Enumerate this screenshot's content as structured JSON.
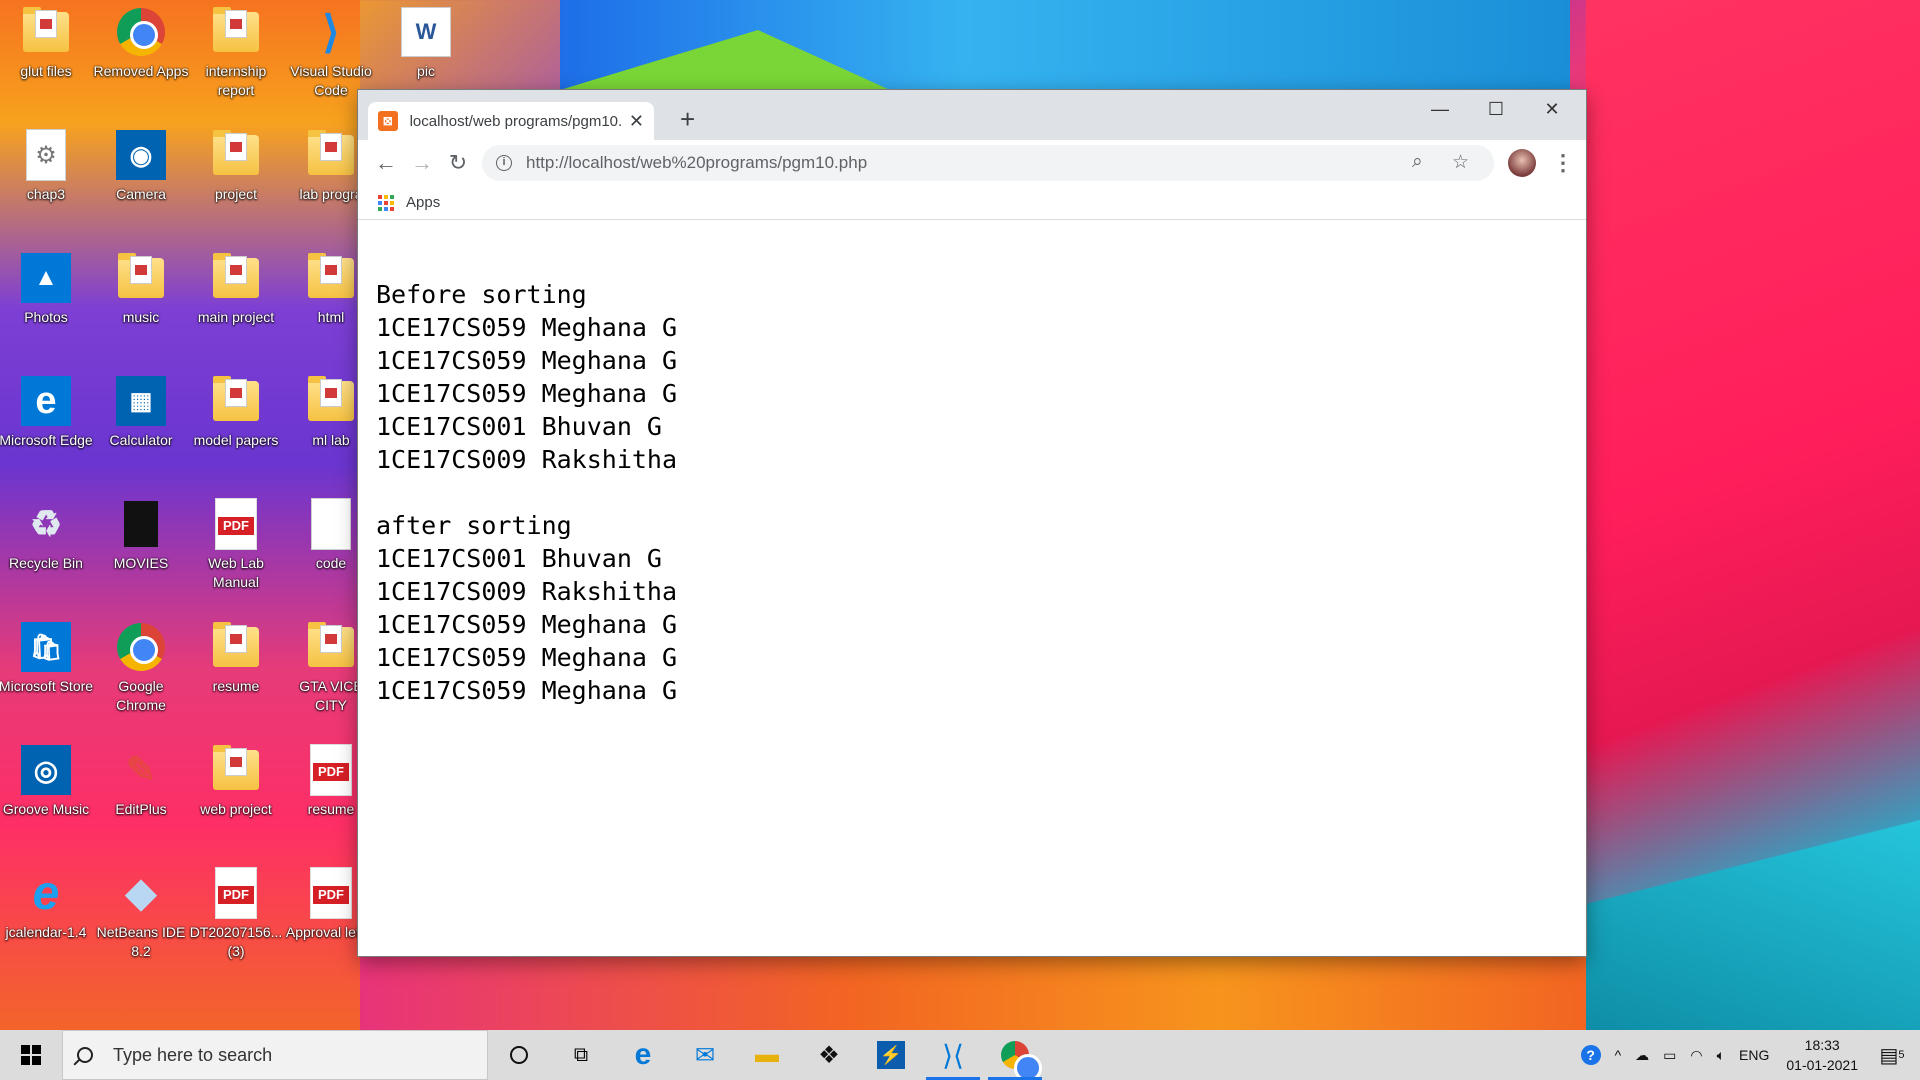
{
  "desktop": {
    "icons": [
      {
        "label": "glut files",
        "type": "folder"
      },
      {
        "label": "Removed Apps",
        "type": "chrome"
      },
      {
        "label": "internship report",
        "type": "folder"
      },
      {
        "label": "Visual Studio Code",
        "type": "vscode"
      },
      {
        "label": "pic",
        "type": "word"
      },
      {
        "label": "chap3",
        "type": "settings-file"
      },
      {
        "label": "Camera",
        "type": "camera"
      },
      {
        "label": "project",
        "type": "pdf-folder"
      },
      {
        "label": "lab progra",
        "type": "folder"
      },
      {
        "label": "Photos",
        "type": "photos"
      },
      {
        "label": "music",
        "type": "folder"
      },
      {
        "label": "main project",
        "type": "folder"
      },
      {
        "label": "html",
        "type": "folder"
      },
      {
        "label": "Microsoft Edge",
        "type": "edge"
      },
      {
        "label": "Calculator",
        "type": "calculator"
      },
      {
        "label": "model papers",
        "type": "folder"
      },
      {
        "label": "ml lab",
        "type": "folder"
      },
      {
        "label": "Recycle Bin",
        "type": "recycle"
      },
      {
        "label": "MOVIES",
        "type": "movies"
      },
      {
        "label": "Web Lab Manual",
        "type": "pdf"
      },
      {
        "label": "code",
        "type": "blank"
      },
      {
        "label": "Microsoft Store",
        "type": "store"
      },
      {
        "label": "Google Chrome",
        "type": "chrome"
      },
      {
        "label": "resume",
        "type": "folder"
      },
      {
        "label": "GTA VICE CITY",
        "type": "folder"
      },
      {
        "label": "Groove Music",
        "type": "groove"
      },
      {
        "label": "EditPlus",
        "type": "editplus"
      },
      {
        "label": "web project",
        "type": "folder"
      },
      {
        "label": "resume",
        "type": "pdf"
      },
      {
        "label": "jcalendar-1.4",
        "type": "ie"
      },
      {
        "label": "NetBeans IDE 8.2",
        "type": "netbeans"
      },
      {
        "label": "DT20207156... (3)",
        "type": "pdf"
      },
      {
        "label": "Approval letter",
        "type": "pdf"
      }
    ]
  },
  "browser": {
    "tab_title": "localhost/web programs/pgm10.",
    "new_tab": "+",
    "url": "http://localhost/web%20programs/pgm10.php",
    "bookmarks_apps": "Apps",
    "window_controls": {
      "minimize": "—",
      "maximize": "☐",
      "close": "✕"
    }
  },
  "page": {
    "before_heading": "Before sorting",
    "before_rows": [
      "1CE17CS059 Meghana G",
      "1CE17CS059 Meghana G",
      "1CE17CS059 Meghana G",
      "1CE17CS001 Bhuvan G",
      "1CE17CS009 Rakshitha"
    ],
    "after_heading": "after sorting",
    "after_rows": [
      "1CE17CS001 Bhuvan G",
      "1CE17CS009 Rakshitha",
      "1CE17CS059 Meghana G",
      "1CE17CS059 Meghana G",
      "1CE17CS059 Meghana G"
    ]
  },
  "taskbar": {
    "search_placeholder": "Type here to search",
    "language": "ENG",
    "time": "18:33",
    "date": "01-01-2021",
    "notification_count": "5"
  },
  "colors": {
    "accent": "#1a73e8",
    "xampp_orange": "#f37021",
    "pdf_red": "#d71f26"
  }
}
